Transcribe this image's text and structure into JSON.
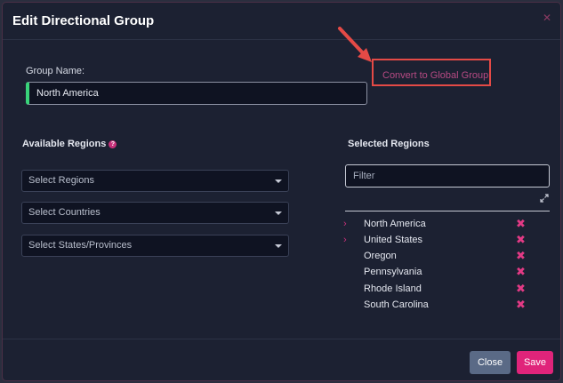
{
  "dialog": {
    "title": "Edit Directional Group"
  },
  "group_name": {
    "label": "Group Name:",
    "value": "North America"
  },
  "convert_link": "Convert to Global Group",
  "available": {
    "heading": "Available Regions",
    "selects": [
      {
        "placeholder": "Select Regions"
      },
      {
        "placeholder": "Select Countries"
      },
      {
        "placeholder": "Select States/Provinces"
      }
    ]
  },
  "selected": {
    "heading": "Selected Regions",
    "filter_placeholder": "Filter",
    "items": [
      {
        "label": "North America",
        "expandable": true
      },
      {
        "label": "United States",
        "expandable": true
      },
      {
        "label": "Oregon",
        "expandable": false
      },
      {
        "label": "Pennsylvania",
        "expandable": false
      },
      {
        "label": "Rhode Island",
        "expandable": false
      },
      {
        "label": "South Carolina",
        "expandable": false
      }
    ]
  },
  "footer": {
    "close_label": "Close",
    "save_label": "Save"
  },
  "icons": {
    "help": "question-circle-icon",
    "close": "close-icon",
    "expand": "expand-icon",
    "remove": "remove-x-icon",
    "chevron": "chevron-right-icon"
  },
  "colors": {
    "accent": "#e0247a",
    "valid": "#39d37a",
    "annotation": "#e44a46"
  }
}
